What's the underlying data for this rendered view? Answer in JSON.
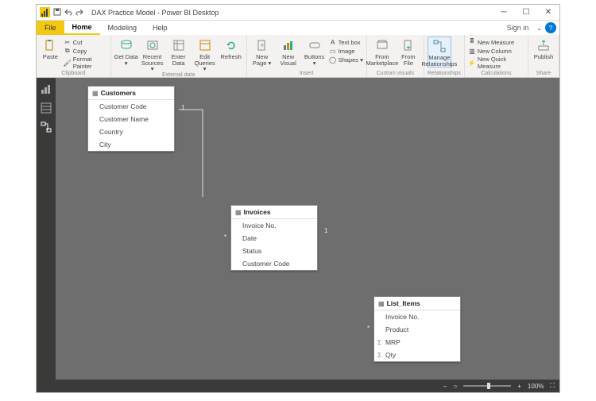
{
  "titlebar": {
    "title": "DAX Practice Model - Power BI Desktop"
  },
  "tabs": {
    "file": "File",
    "items": [
      "Home",
      "Modeling",
      "Help"
    ],
    "active": "Home",
    "signin": "Sign in"
  },
  "ribbon": {
    "clipboard": {
      "paste": "Paste",
      "cut": "Cut",
      "copy": "Copy",
      "format_painter": "Format Painter",
      "label": "Clipboard"
    },
    "external": {
      "get_data": "Get Data",
      "recent_sources": "Recent Sources",
      "enter_data": "Enter Data",
      "edit_queries": "Edit Queries",
      "refresh": "Refresh",
      "label": "External data"
    },
    "insert": {
      "new_page": "New Page",
      "new_visual": "New Visual",
      "buttons": "Buttons",
      "text_box": "Text box",
      "image": "Image",
      "shapes": "Shapes",
      "label": "Insert"
    },
    "custom": {
      "marketplace": "From Marketplace",
      "file": "From File",
      "label": "Custom visuals"
    },
    "relationships": {
      "manage": "Manage Relationships",
      "label": "Relationships"
    },
    "calculations": {
      "new_measure": "New Measure",
      "new_column": "New Column",
      "new_quick": "New Quick Measure",
      "label": "Calculations"
    },
    "share": {
      "publish": "Publish",
      "label": "Share"
    }
  },
  "tables": {
    "customers": {
      "name": "Customers",
      "fields": [
        "Customer Code",
        "Customer Name",
        "Country",
        "City"
      ]
    },
    "invoices": {
      "name": "Invoices",
      "fields": [
        "Invoice No.",
        "Date",
        "Status",
        "Customer Code"
      ]
    },
    "list_items": {
      "name": "List_Items",
      "fields": [
        "Invoice No.",
        "Product",
        "MRP",
        "Qty"
      ]
    }
  },
  "cardinality": {
    "one": "1",
    "many": "*"
  },
  "statusbar": {
    "zoom": "100%"
  }
}
